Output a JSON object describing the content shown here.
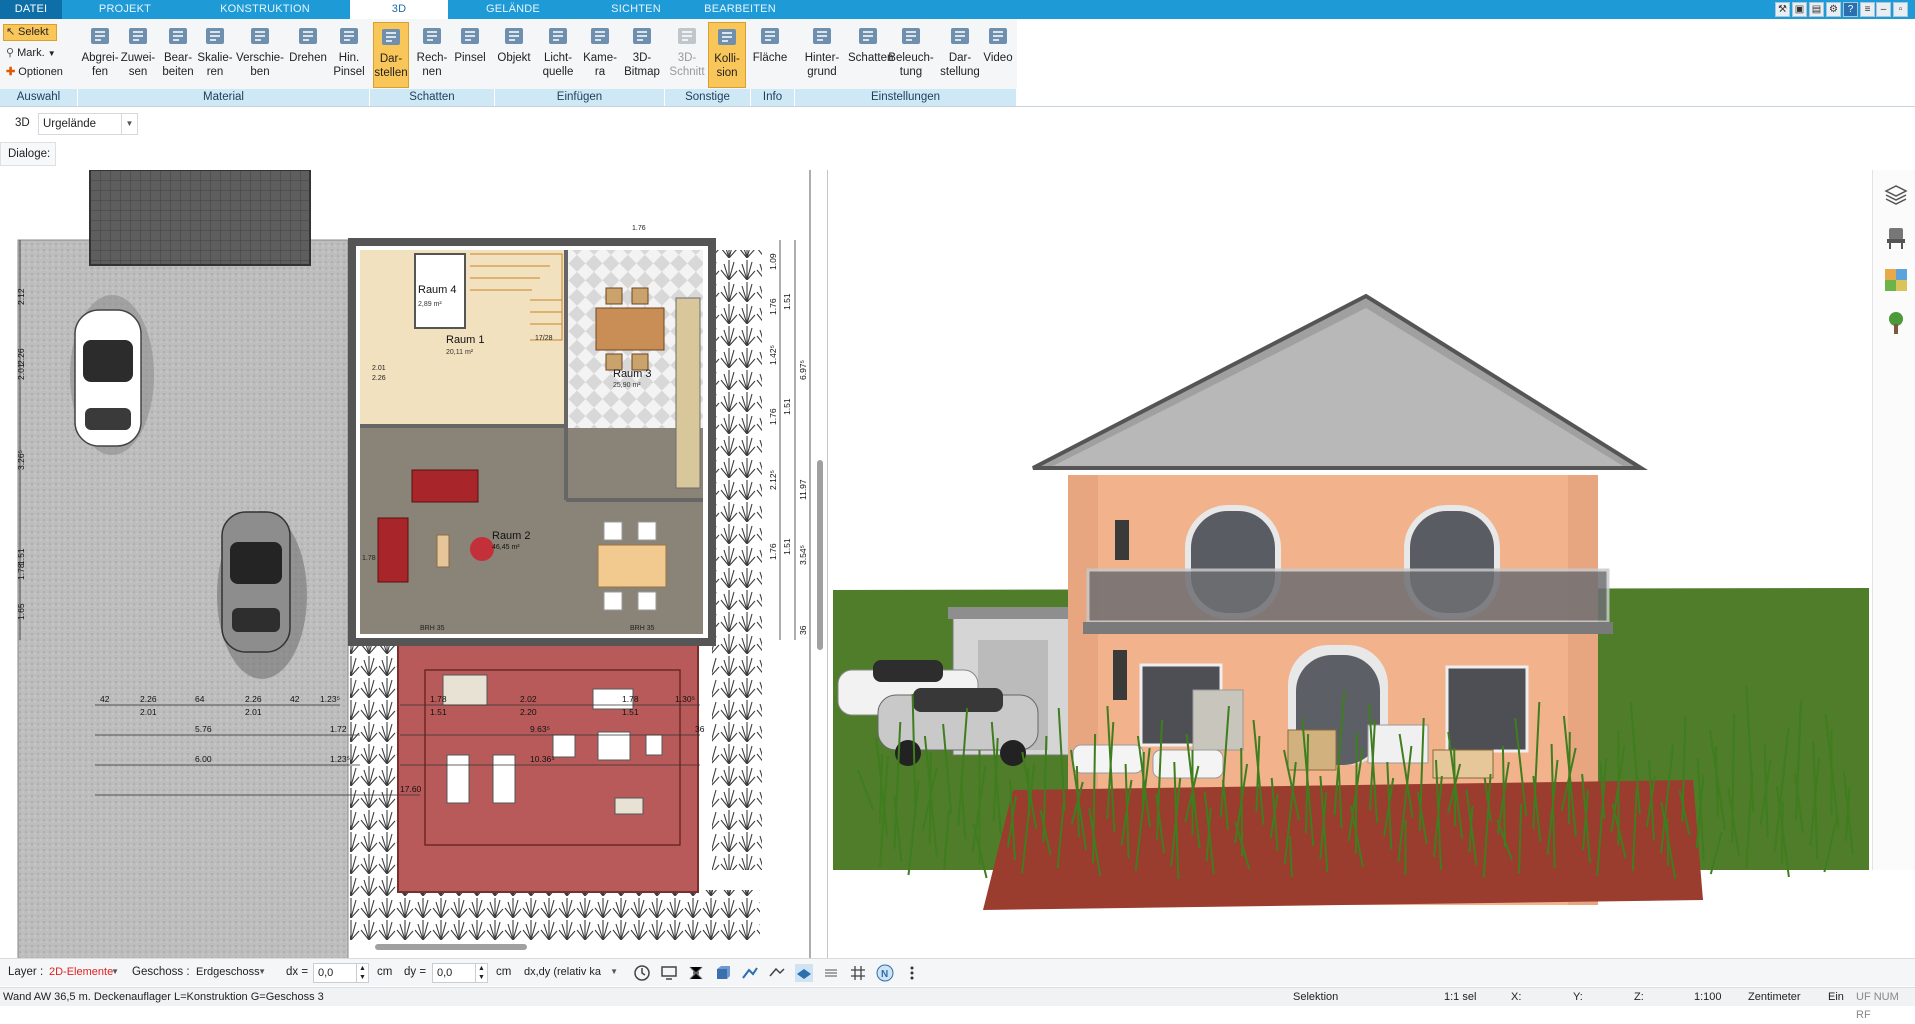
{
  "tabs": [
    {
      "label": "DATEI",
      "active": false
    },
    {
      "label": "PROJEKT",
      "active": false
    },
    {
      "label": "KONSTRUKTION",
      "active": false
    },
    {
      "label": "3D",
      "active": true
    },
    {
      "label": "GELÄNDE",
      "active": false
    },
    {
      "label": "SICHTEN",
      "active": false
    },
    {
      "label": "BEARBEITEN",
      "active": false
    }
  ],
  "ribbon": {
    "auswahl": {
      "selekt": "Selekt",
      "mark": "Mark.",
      "optionen": "Optionen"
    },
    "buttons": [
      {
        "l1": "Abgrei-",
        "l2": "fen",
        "icon": "eyedropper-icon"
      },
      {
        "l1": "Zuwei-",
        "l2": "sen",
        "icon": "assign-material-icon"
      },
      {
        "l1": "Bear-",
        "l2": "beiten",
        "icon": "edit-material-icon"
      },
      {
        "l1": "Skalie-",
        "l2": "ren",
        "icon": "scale-icon"
      },
      {
        "l1": "Verschie-",
        "l2": "ben",
        "icon": "move-icon"
      },
      {
        "l1": "Drehen",
        "l2": "",
        "icon": "rotate-icon"
      },
      {
        "l1": "Hin.",
        "l2": "Pinsel",
        "icon": "brush-icon"
      },
      {
        "l1": "Dar-",
        "l2": "stellen",
        "icon": "render-icon"
      },
      {
        "l1": "Rech-",
        "l2": "nen",
        "icon": "calculate-icon"
      },
      {
        "l1": "Pinsel",
        "l2": "",
        "icon": "paint-icon"
      },
      {
        "l1": "Objekt",
        "l2": "",
        "icon": "object-icon"
      },
      {
        "l1": "Licht-",
        "l2": "quelle",
        "icon": "light-bulb-icon"
      },
      {
        "l1": "Kame-",
        "l2": "ra",
        "icon": "camera-icon"
      },
      {
        "l1": "3D-",
        "l2": "Bitmap",
        "icon": "tree-icon"
      },
      {
        "l1": "3D-",
        "l2": "Schnitt",
        "icon": "section-icon"
      },
      {
        "l1": "Kolli-",
        "l2": "sion",
        "icon": "collision-icon"
      },
      {
        "l1": "Fläche",
        "l2": "",
        "icon": "area-icon"
      },
      {
        "l1": "Hinter-",
        "l2": "grund",
        "icon": "background-icon"
      },
      {
        "l1": "Schatten",
        "l2": "",
        "icon": "shadow-icon"
      },
      {
        "l1": "Beleuch-",
        "l2": "tung",
        "icon": "lighting-icon"
      },
      {
        "l1": "Dar-",
        "l2": "stellung",
        "icon": "display-icon"
      },
      {
        "l1": "Video",
        "l2": "",
        "icon": "video-icon"
      }
    ],
    "groups": [
      "Auswahl",
      "Material",
      "Schatten",
      "Einfügen",
      "Sonstige",
      "Info",
      "Einstellungen"
    ]
  },
  "view": {
    "mode": "3D",
    "selection": "Urgelände",
    "dialog_label": "Dialoge:"
  },
  "plan": {
    "rooms": [
      {
        "name": "Raum 4",
        "area": "2,89 m²"
      },
      {
        "name": "Raum 1",
        "area": "20,11 m²"
      },
      {
        "name": "Raum 3",
        "area": "25,90 m²"
      },
      {
        "name": "Raum 2",
        "area": "46,45 m²"
      }
    ],
    "dims_bottom": [
      "42",
      "2.26",
      "64",
      "2.26",
      "42",
      "1.23⁵",
      "2.01",
      "2.01",
      "5.76",
      "1.72",
      "6.00",
      "1.23⁵",
      "17.60",
      "1.78",
      "1.51",
      "2.02",
      "2.20",
      "1.78",
      "1.51",
      "1.30⁵",
      "9.63⁵",
      "10.36⁵",
      "36"
    ],
    "dims_right": [
      "1.09",
      "1.51",
      "1.76",
      "1.42⁵",
      "6.97⁵",
      "1.51",
      "1.76",
      "2.12⁵",
      "11.97",
      "1.51",
      "1.76",
      "3.54⁵",
      "36"
    ],
    "dims_left": [
      "2.12",
      "2.26",
      "2.01",
      "3.26⁵",
      "1.51",
      "1.78",
      "1.65"
    ],
    "misc": [
      "1.76",
      "2.01",
      "2.26",
      "1.78",
      "BRH 35",
      "BRH 35",
      "17/28"
    ]
  },
  "options": {
    "layer_label": "Layer :",
    "layer_value": "2D-Elemente",
    "geschoss_label": "Geschoss :",
    "geschoss_value": "Erdgeschoss",
    "dx_label": "dx =",
    "dx_value": "0,0",
    "dy_label": "dy =",
    "dy_value": "0,0",
    "unit": "cm",
    "mode_value": "dx,dy (relativ ka"
  },
  "status": {
    "message": "Wand AW 36,5 m. Deckenauflager L=Konstruktion G=Geschoss 3",
    "mode": "Selektion",
    "sel": "1:1 sel",
    "x": "X:",
    "y": "Y:",
    "z": "Z:",
    "scale": "1:100",
    "unit": "Zentimeter",
    "ein": "Ein",
    "flags": "UF NUM RF"
  },
  "colors": {
    "ribbon_blue": "#1e9ad6",
    "group_bg": "#cfe8f6",
    "active_btn": "#f9c65a",
    "layer_red": "#e02020"
  }
}
